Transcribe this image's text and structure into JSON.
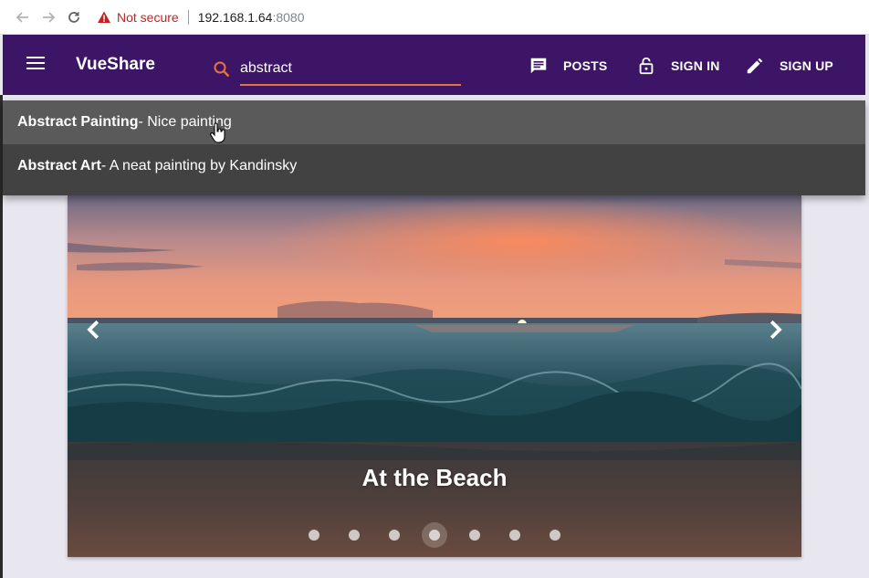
{
  "browser": {
    "security_label": "Not secure",
    "url_host": "192.168.1.64",
    "url_port": ":8080"
  },
  "app": {
    "brand": "VueShare",
    "search_value": "abstract",
    "nav": {
      "posts": "POSTS",
      "sign_in": "SIGN IN",
      "sign_up": "SIGN UP"
    }
  },
  "suggestions": [
    {
      "title": "Abstract Painting",
      "desc": " - Nice painting"
    },
    {
      "title": "Abstract Art",
      "desc": " - A neat painting by Kandinsky"
    }
  ],
  "carousel": {
    "caption": "At the Beach",
    "slide_count": 7,
    "active_index": 3
  },
  "colors": {
    "app_bar": "#3d1566",
    "search_underline": "#e8743b",
    "dropdown": "#424242",
    "dropdown_hover": "#5a5a5a"
  }
}
